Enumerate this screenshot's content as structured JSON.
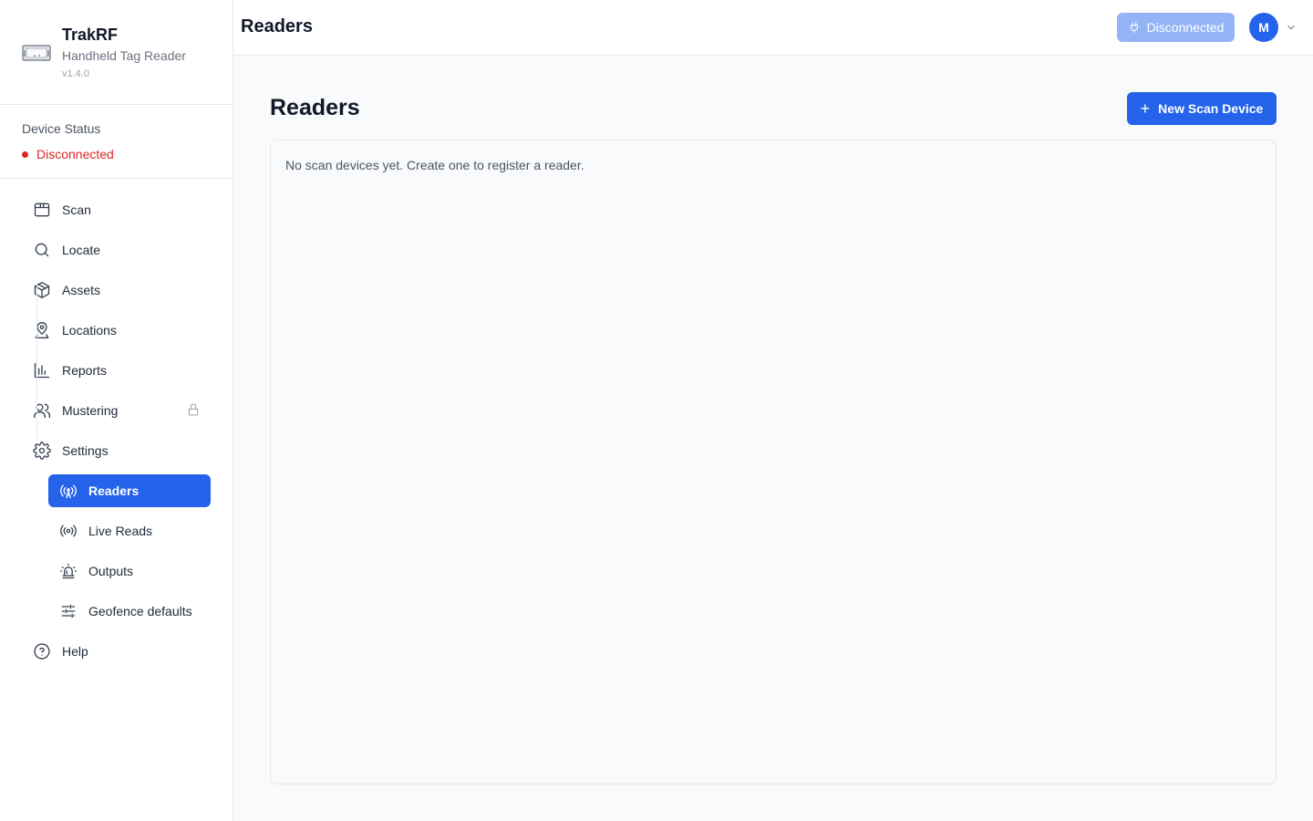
{
  "brand": {
    "title": "TrakRF",
    "subtitle": "Handheld Tag Reader",
    "version": "v1.4.0"
  },
  "device_status": {
    "label": "Device Status",
    "value": "Disconnected",
    "color": "#dc2626"
  },
  "nav": {
    "items": [
      {
        "label": "Scan",
        "icon": "package-icon"
      },
      {
        "label": "Locate",
        "icon": "search-icon"
      },
      {
        "label": "Assets",
        "icon": "box-icon"
      },
      {
        "label": "Locations",
        "icon": "map-pin-user-icon"
      },
      {
        "label": "Reports",
        "icon": "bar-chart-icon"
      },
      {
        "label": "Mustering",
        "icon": "users-icon",
        "locked": true
      },
      {
        "label": "Settings",
        "icon": "gear-icon"
      },
      {
        "label": "Help",
        "icon": "help-circle-icon"
      }
    ],
    "settings_sub": [
      {
        "label": "Readers",
        "icon": "antenna-icon",
        "active": true
      },
      {
        "label": "Live Reads",
        "icon": "broadcast-icon"
      },
      {
        "label": "Outputs",
        "icon": "siren-icon"
      },
      {
        "label": "Geofence defaults",
        "icon": "sliders-icon"
      }
    ]
  },
  "header": {
    "title": "Readers",
    "connection_button": "Disconnected",
    "avatar_initial": "M"
  },
  "main": {
    "title": "Readers",
    "new_button": "New Scan Device",
    "empty_message": "No scan devices yet. Create one to register a reader."
  },
  "colors": {
    "accent": "#2563eb",
    "accent_disabled": "#93b4f6",
    "danger": "#dc2626"
  }
}
